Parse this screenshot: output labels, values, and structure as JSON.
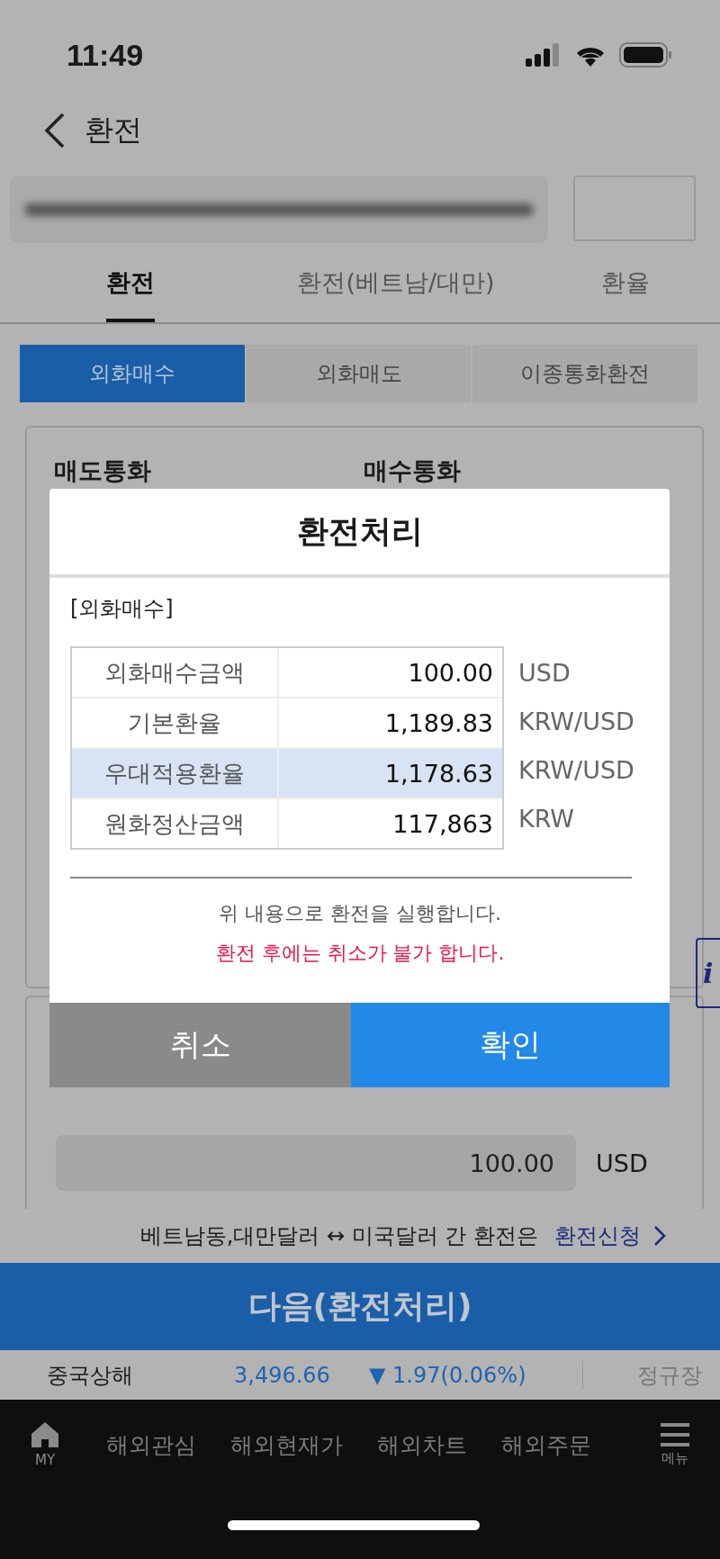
{
  "status_bar": {
    "time": "11:49"
  },
  "header": {
    "title": "환전"
  },
  "tabs": [
    {
      "label": "환전",
      "selected": true
    },
    {
      "label": "환전(베트남/대만)",
      "selected": false
    },
    {
      "label": "환율",
      "selected": false
    }
  ],
  "segments": [
    {
      "label": "외화매수",
      "selected": true
    },
    {
      "label": "외화매도",
      "selected": false
    },
    {
      "label": "이종통화환전",
      "selected": false
    }
  ],
  "form": {
    "sell_currency_label": "매도통화",
    "buy_currency_label": "매수통화",
    "amount": "100.00",
    "amount_unit": "USD",
    "info_tab": "i"
  },
  "notice": {
    "text": "베트남동,대만달러 ↔ 미국달러 간 환전은",
    "link": "환전신청"
  },
  "next_button": "다음(환전처리)",
  "ticker": {
    "name": "중국상해",
    "price": "3,496.66",
    "change": "▼ 1.97",
    "percent": "(0.06%)",
    "session": "정규장"
  },
  "bottom_nav": {
    "home_label": "MY",
    "items": [
      "해외관심",
      "해외현재가",
      "해외차트",
      "해외주문"
    ],
    "menu_label": "메뉴"
  },
  "dialog": {
    "title": "환전처리",
    "section": "[외화매수]",
    "rows": [
      {
        "label": "외화매수금액",
        "value": "100.00",
        "unit": "USD",
        "selected": false
      },
      {
        "label": "기본환율",
        "value": "1,189.83",
        "unit": "KRW/USD",
        "selected": false
      },
      {
        "label": "우대적용환율",
        "value": "1,178.63",
        "unit": "KRW/USD",
        "selected": true
      },
      {
        "label": "원화정산금액",
        "value": "117,863",
        "unit": "KRW",
        "selected": false
      }
    ],
    "message": "위 내용으로 환전을 실행합니다.",
    "warning": "환전 후에는 취소가 불가 합니다.",
    "cancel": "취소",
    "confirm": "확인"
  }
}
